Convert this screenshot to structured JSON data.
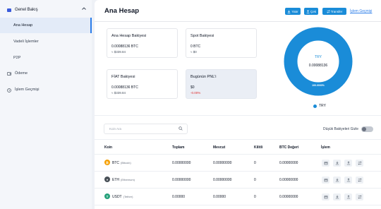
{
  "sidebar": {
    "group": {
      "label": "Genel Bakış"
    },
    "items": [
      {
        "label": "Ana Hesap",
        "active": true
      },
      {
        "label": "Vadeli İşlemler",
        "active": false
      },
      {
        "label": "P2P",
        "active": false
      }
    ],
    "main_items": [
      {
        "label": "Ödeme",
        "icon": "wallet-icon"
      },
      {
        "label": "İşlem Geçmişi",
        "icon": "history-icon"
      }
    ]
  },
  "header": {
    "title": "Ana Hesap",
    "buttons": [
      {
        "label": "Yatır",
        "icon": "download-icon"
      },
      {
        "label": "Çek",
        "icon": "upload-icon"
      },
      {
        "label": "Transfer",
        "icon": "transfer-icon"
      }
    ],
    "history_link": "İşlem Geçmişi"
  },
  "cards": [
    {
      "title": "Ana Hesap Bakiyesi",
      "value": "0.00088136 BTC",
      "sub": "≈ $339.84",
      "shaded": false,
      "negative": false
    },
    {
      "title": "Spot Bakiyesi",
      "value": "0 BTC",
      "sub": "≈ $0",
      "shaded": false,
      "negative": false
    },
    {
      "title": "FİAT Bakiyesi",
      "value": "0.00088136 BTC",
      "sub": "≈ $339.84",
      "shaded": false,
      "negative": false
    },
    {
      "title": "Bugünün PNL'i",
      "value": "$0",
      "sub": "-0.00%",
      "shaded": true,
      "negative": true
    }
  ],
  "donut": {
    "center_label": "TRY",
    "center_value": "0.00088136",
    "slice_label": "100.0000%",
    "share": 1.0,
    "color": "#1a8cd8"
  },
  "legend": {
    "label": "TRY",
    "color": "#1a8cd8"
  },
  "search": {
    "placeholder": "Koin Ara"
  },
  "toggle": {
    "label": "Düşük Bakiyeleri Gizle",
    "on": false
  },
  "table": {
    "columns": [
      "Koin",
      "Toplam",
      "Mevcut",
      "Kilitli",
      "BTC Değeri",
      "İşlem"
    ],
    "rows": [
      {
        "symbol": "BTC",
        "name": "(Bitcoin)",
        "total": "0.00000000",
        "available": "0.00000000",
        "locked": "0",
        "btc_value": "0.00000000",
        "icon_color": "#f59f00",
        "icon_glyph": "₿"
      },
      {
        "symbol": "ETH",
        "name": "(Ethereum)",
        "total": "0.00000000",
        "available": "0.00000000",
        "locked": "0",
        "btc_value": "0.00000000",
        "icon_color": "#495057",
        "icon_glyph": "♦"
      },
      {
        "symbol": "USDT",
        "name": "(Tether)",
        "total": "0.00000",
        "available": "0.00000",
        "locked": "0",
        "btc_value": "0.00000000",
        "icon_color": "#26a17b",
        "icon_glyph": "T"
      }
    ]
  }
}
